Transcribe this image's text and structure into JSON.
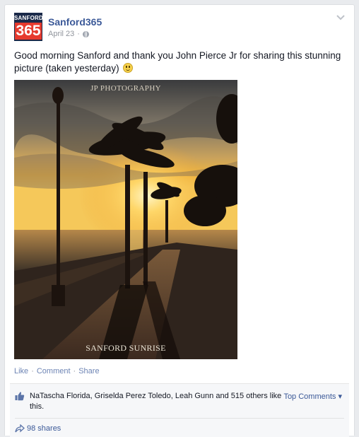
{
  "post": {
    "page_name": "Sanford365",
    "date": "April 23",
    "separator": "·",
    "privacy_icon": "globe-icon",
    "text": "Good morning Sanford and thank you John Pierce Jr for sharing this stunning picture (taken yesterday)",
    "emoji": "smiley-icon"
  },
  "avatar": {
    "top_text": "SANFORD",
    "number_text": "365"
  },
  "photo": {
    "credit": "JP PHOTOGRAPHY",
    "caption": "SANFORD SUNRISE"
  },
  "actions": {
    "like": "Like",
    "comment": "Comment",
    "share": "Share",
    "dot": "·"
  },
  "ufi": {
    "likes_summary": "NaTascha Florida, Griselda Perez Toledo, Leah Gunn and 515 others like this.",
    "top_comments": "Top Comments ▾",
    "shares": "98 shares"
  },
  "colors": {
    "link": "#3b5998",
    "action_link": "#6d84b4",
    "meta": "#90949c",
    "brand_red": "#e63a2e",
    "brand_navy": "#1b2a4a"
  }
}
